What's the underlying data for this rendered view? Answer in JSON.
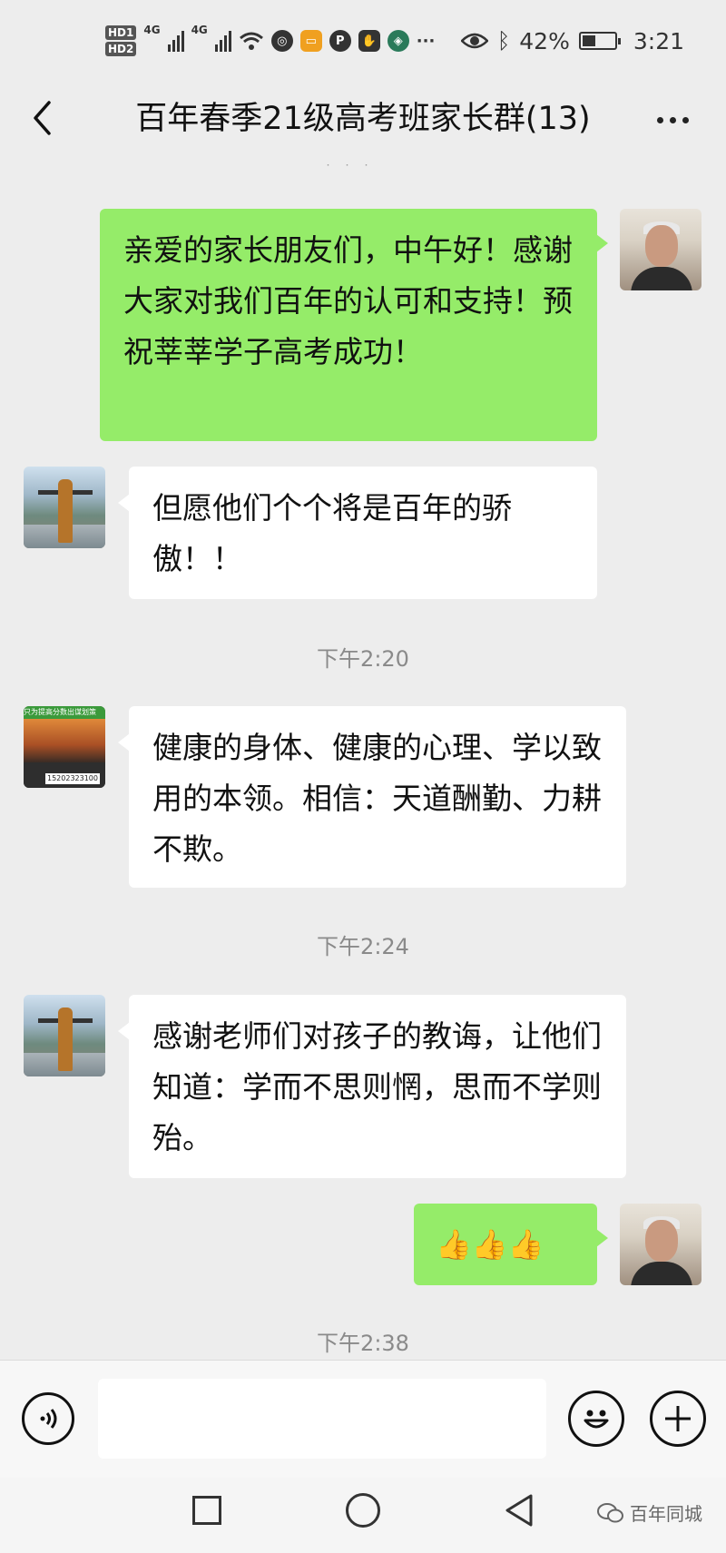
{
  "status_bar": {
    "hd1": "HD1",
    "hd2": "HD2",
    "net1": "4G",
    "net2": "4G",
    "more": "···",
    "battery_percent": "42%",
    "battery_level": 0.42,
    "time": "3:21"
  },
  "header": {
    "title": "百年春季21级高考班家长群(13)"
  },
  "messages": [
    {
      "side": "right",
      "avatar": "teacher",
      "text": "亲爱的家长朋友们，中午好！感谢大家对我们百年的认可和支持！预祝莘莘学子高考成功！"
    },
    {
      "side": "left",
      "avatar": "mountain-woman",
      "text": "但愿他们个个将是百年的骄傲！！"
    },
    {
      "timestamp": "下午2:20"
    },
    {
      "side": "left",
      "avatar": "ad-sunset",
      "avatar_top_text": "只为提高分数出谋划策",
      "avatar_phone": "15202323100",
      "text": "健康的身体、健康的心理、学以致用的本领。相信：天道酬勤、力耕不欺。"
    },
    {
      "timestamp": "下午2:24"
    },
    {
      "side": "left",
      "avatar": "mountain-woman",
      "text": "感谢老师们对孩子的教诲，让他们知道：学而不思则惘，思而不学则殆。"
    },
    {
      "side": "right",
      "avatar": "teacher",
      "text": "👍👍👍"
    },
    {
      "timestamp": "下午2:38"
    }
  ],
  "input_bar": {
    "voice_icon": "voice-icon",
    "emoji_icon": "smiley-icon",
    "add_icon": "plus-icon"
  },
  "watermark": "百年同城",
  "colors": {
    "background": "#ededed",
    "own_bubble": "#95ec69",
    "other_bubble": "#ffffff"
  }
}
